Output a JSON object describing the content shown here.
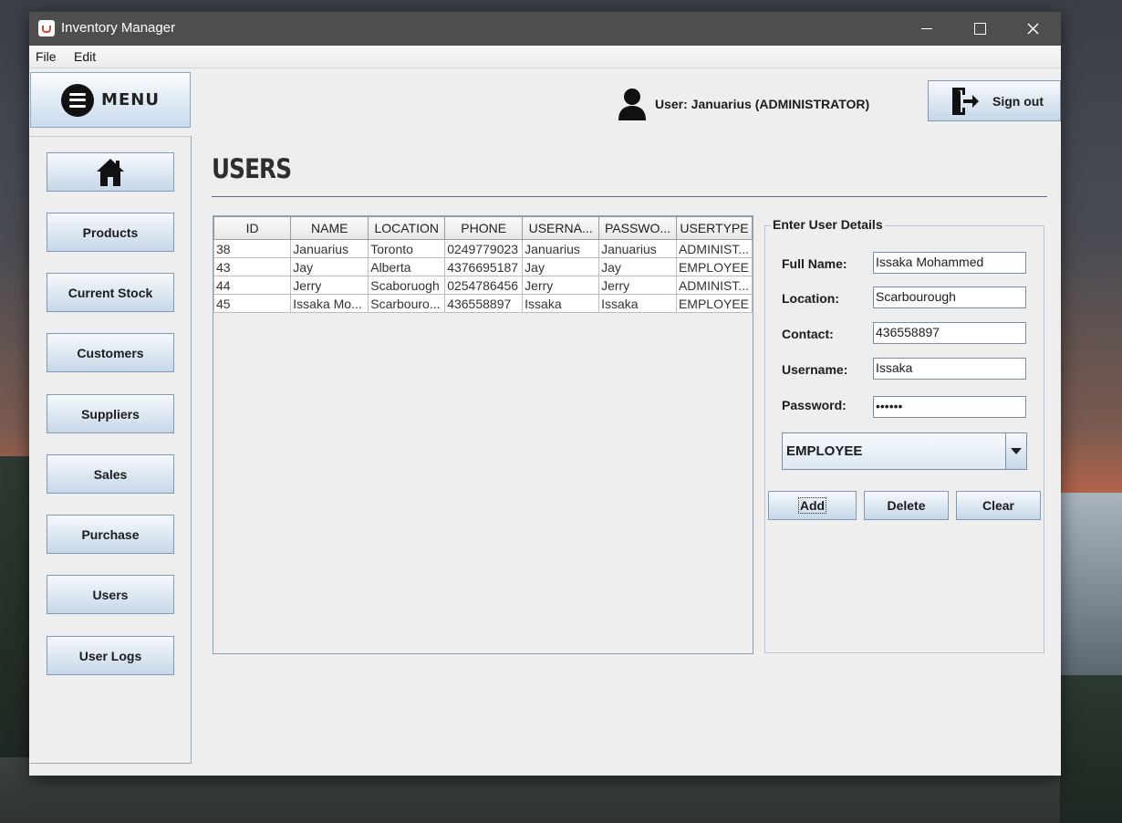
{
  "window": {
    "title": "Inventory Manager"
  },
  "menubar": {
    "file": "File",
    "edit": "Edit"
  },
  "sidebar": {
    "header_label": "MENU",
    "items": [
      {
        "label": "Products"
      },
      {
        "label": "Current Stock"
      },
      {
        "label": "Customers"
      },
      {
        "label": "Suppliers"
      },
      {
        "label": "Sales"
      },
      {
        "label": "Purchase"
      },
      {
        "label": "Users"
      },
      {
        "label": "User Logs"
      }
    ]
  },
  "header": {
    "user_label": "User: Januarius (ADMINISTRATOR)",
    "signout_label": "Sign out"
  },
  "page": {
    "title": "USERS"
  },
  "table": {
    "columns": [
      "ID",
      "NAME",
      "LOCATION",
      "PHONE",
      "USERNA...",
      "PASSWO...",
      "USERTYPE"
    ],
    "rows": [
      [
        "38",
        "Januarius",
        "Toronto",
        "0249779023",
        "Januarius",
        "Januarius",
        "ADMINIST..."
      ],
      [
        "43",
        "Jay",
        "Alberta",
        "4376695187",
        "Jay",
        "Jay",
        "EMPLOYEE"
      ],
      [
        "44",
        "Jerry",
        "Scaboruogh",
        "0254786456",
        "Jerry",
        "Jerry",
        "ADMINIST..."
      ],
      [
        "45",
        "Issaka Mo...",
        "Scarbouro...",
        "436558897",
        "Issaka",
        "Issaka",
        "EMPLOYEE"
      ]
    ]
  },
  "details": {
    "title": "Enter User Details",
    "fullname_label": "Full Name:",
    "fullname_value": "Issaka Mohammed",
    "location_label": "Location:",
    "location_value": "Scarbourough",
    "contact_label": "Contact:",
    "contact_value": "436558897",
    "username_label": "Username:",
    "username_value": "Issaka",
    "password_label": "Password:",
    "password_value": "••••••",
    "usertype_value": "EMPLOYEE",
    "add_label": "Add",
    "delete_label": "Delete",
    "clear_label": "Clear"
  },
  "colors": {
    "titlebar": "#4e4e4e",
    "button_top": "#f6f9fc",
    "button_bottom": "#c6d7e8",
    "border": "#7f9ab7"
  }
}
